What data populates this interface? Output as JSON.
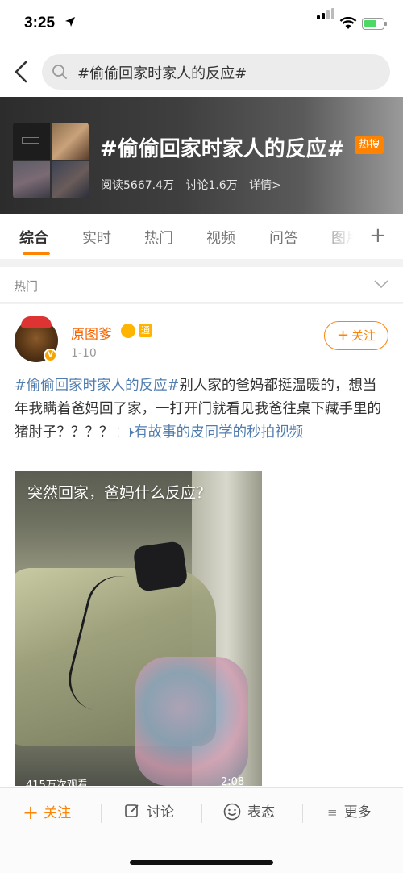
{
  "status_bar": {
    "time": "3:25"
  },
  "search": {
    "query": "#偷偷回家时家人的反应#"
  },
  "topic": {
    "title": "#偷偷回家时家人的反应#",
    "hot_badge": "热搜",
    "reads": "阅读5667.4万",
    "discussions": "讨论1.6万",
    "details": "详情>"
  },
  "tabs": [
    {
      "label": "综合",
      "active": true
    },
    {
      "label": "实时"
    },
    {
      "label": "热门"
    },
    {
      "label": "视频"
    },
    {
      "label": "问答"
    },
    {
      "label": "图片"
    }
  ],
  "section": {
    "label": "热门"
  },
  "post": {
    "author": "原图爹",
    "badge_text": "通",
    "date": "1-10",
    "follow_label": "关注",
    "hashtag": "#偷偷回家时家人的反应#",
    "body": "别人家的爸妈都挺温暖的，想当年我瞒着爸妈回了家，一打开门就看见我爸往桌下藏手里的猪肘子？？？？",
    "video_link": "有故事的皮同学的秒拍视频",
    "video_caption": "突然回家，爸妈什么反应？",
    "views": "415万次观看",
    "duration": "2:08"
  },
  "bottom_bar": {
    "follow": "关注",
    "discuss": "讨论",
    "emote": "表态",
    "more": "更多"
  },
  "colors": {
    "accent": "#ff8200",
    "link": "#507daf",
    "author": "#f86300"
  }
}
